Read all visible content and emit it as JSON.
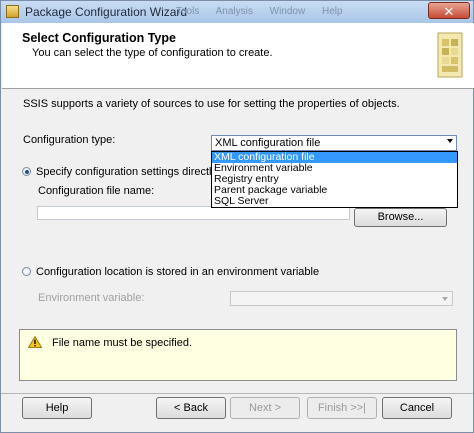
{
  "window": {
    "title": "Package Configuration Wizard",
    "background_menu": [
      "Tools",
      "Analysis",
      "Window",
      "Help"
    ],
    "close_label": "✕"
  },
  "header": {
    "title": "Select Configuration Type",
    "subtitle": "You can select the type of configuration to create."
  },
  "description": "SSIS supports a variety of sources to use for setting the properties of objects.",
  "configuration_type": {
    "label": "Configuration type:",
    "selected": "XML configuration file",
    "options": [
      "XML configuration file",
      "Environment variable",
      "Registry entry",
      "Parent package variable",
      "SQL Server"
    ]
  },
  "direct_option": {
    "label": "Specify configuration settings directly",
    "selected": true,
    "file_name_label": "Configuration file name:",
    "file_name_value": "",
    "browse_label": "Browse..."
  },
  "env_option": {
    "label": "Configuration location is stored in an environment variable",
    "selected": false,
    "env_label": "Environment variable:",
    "env_value": ""
  },
  "warning": {
    "icon": "warning-icon",
    "text": "File name must be specified."
  },
  "buttons": {
    "help": "Help",
    "back": "< Back",
    "next": "Next >",
    "finish": "Finish >>|",
    "cancel": "Cancel"
  },
  "colors": {
    "selection": "#3399ff",
    "warning_bg": "#ffffe1",
    "title_bar": "#b9d1ee"
  }
}
